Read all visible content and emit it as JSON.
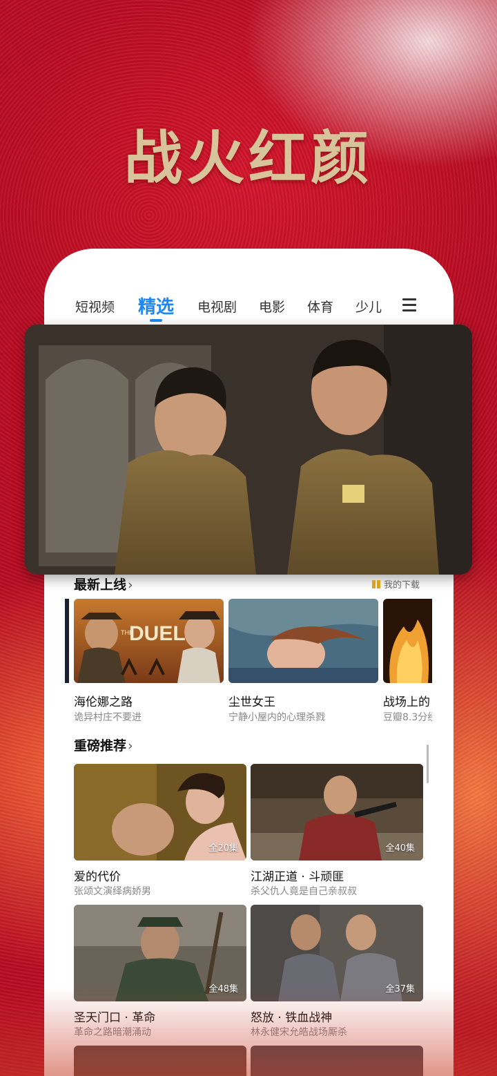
{
  "headline": "战火红颜",
  "tabs": [
    {
      "label": "短视频"
    },
    {
      "label": "精选"
    },
    {
      "label": "电视剧"
    },
    {
      "label": "电影"
    },
    {
      "label": "体育"
    },
    {
      "label": "少儿"
    }
  ],
  "latest": {
    "title": "最新上线",
    "download_label": "我的下载",
    "items": [
      {
        "title": "海伦娜之路",
        "subtitle": "诡异村庄不要进",
        "poster_text": "THE DUEL"
      },
      {
        "title": "尘世女王",
        "subtitle": "宁静小屋内的心理杀戮"
      },
      {
        "title": "战场上的",
        "subtitle": "豆瓣8.3分经"
      }
    ]
  },
  "featured": {
    "title": "重磅推荐",
    "items": [
      {
        "title": "爱的代价",
        "subtitle": "张颂文演绎病娇男",
        "episodes": "全20集"
      },
      {
        "title": "江湖正道 · 斗顽匪",
        "subtitle": "杀父仇人竟是自己亲叔叔",
        "episodes": "全40集"
      },
      {
        "title": "圣天门口 · 革命",
        "subtitle": "革命之路暗潮涌动",
        "episodes": "全48集"
      },
      {
        "title": "怒放 · 铁血战神",
        "subtitle": "林永健宋允皓战场厮杀",
        "episodes": "全37集"
      }
    ]
  },
  "colors": {
    "accent": "#1e88f0",
    "background_red": "#c8102a",
    "headline_gold": "#d8c49a"
  }
}
